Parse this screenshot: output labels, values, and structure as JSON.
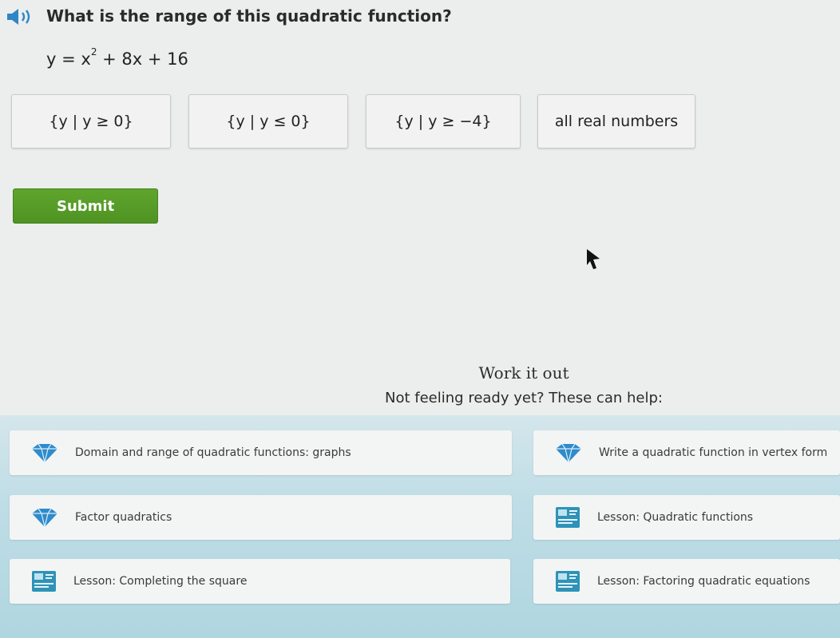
{
  "question": {
    "text": "What is the range of this quadratic function?",
    "equation_lhs": "y = x",
    "equation_exp": "2",
    "equation_rhs": " + 8x + 16"
  },
  "choices": [
    "{y | y ≥ 0}",
    "{y | y ≤ 0}",
    "{y | y ≥ −4}",
    "all real numbers"
  ],
  "submit_label": "Submit",
  "work": {
    "title": "Work it out",
    "subtitle": "Not feeling ready yet? These can help:"
  },
  "help_items": [
    {
      "label": "Domain and range of quadratic functions: graphs",
      "icon": "skill-diamond-icon"
    },
    {
      "label": "Write a quadratic function in vertex form",
      "icon": "skill-diamond-icon"
    },
    {
      "label": "Factor quadratics",
      "icon": "skill-diamond-icon"
    },
    {
      "label": "Lesson: Quadratic functions",
      "icon": "lesson-icon"
    },
    {
      "label": "Lesson: Completing the square",
      "icon": "lesson-icon"
    },
    {
      "label": "Lesson: Factoring quadratic equations",
      "icon": "lesson-icon"
    }
  ],
  "colors": {
    "submit": "#55a028",
    "diamond": "#2f8bcc",
    "lesson": "#2e93b8"
  }
}
